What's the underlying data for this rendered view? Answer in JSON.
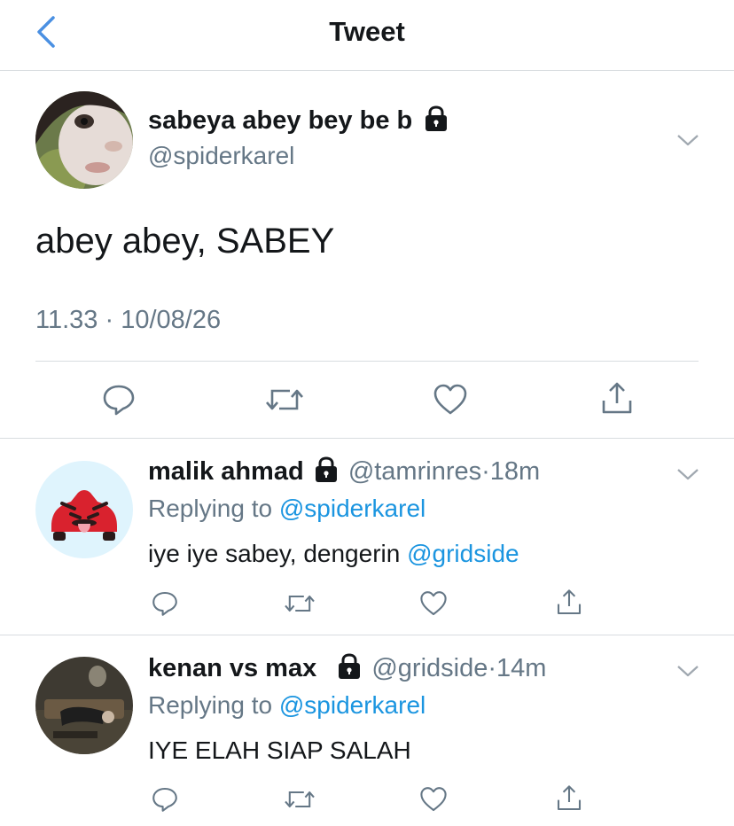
{
  "nav": {
    "title": "Tweet"
  },
  "main_tweet": {
    "display_name": "sabeya abey bey be b",
    "handle": "@spiderkarel",
    "text": "abey abey, SABEY",
    "time": "11.33",
    "date": "10/08/26",
    "dot": "·"
  },
  "replies": [
    {
      "display_name": "malik ahmad",
      "handle": "@tamrinres",
      "dot": "·",
      "age": "18m",
      "replying_prefix": "Replying to ",
      "replying_handle": "@spiderkarel",
      "text": "iye iye sabey, dengerin ",
      "text_mention": "@gridside"
    },
    {
      "display_name": "kenan vs max",
      "handle": "@gridside",
      "dot": "·",
      "age": "14m",
      "replying_prefix": "Replying to ",
      "replying_handle": "@spiderkarel",
      "text": "IYE ELAH SIAP SALAH"
    }
  ],
  "colors": {
    "accent": "#1b95e0",
    "secondary": "#657786",
    "divider": "#d8dce0",
    "back_arrow": "#4a90e2"
  }
}
